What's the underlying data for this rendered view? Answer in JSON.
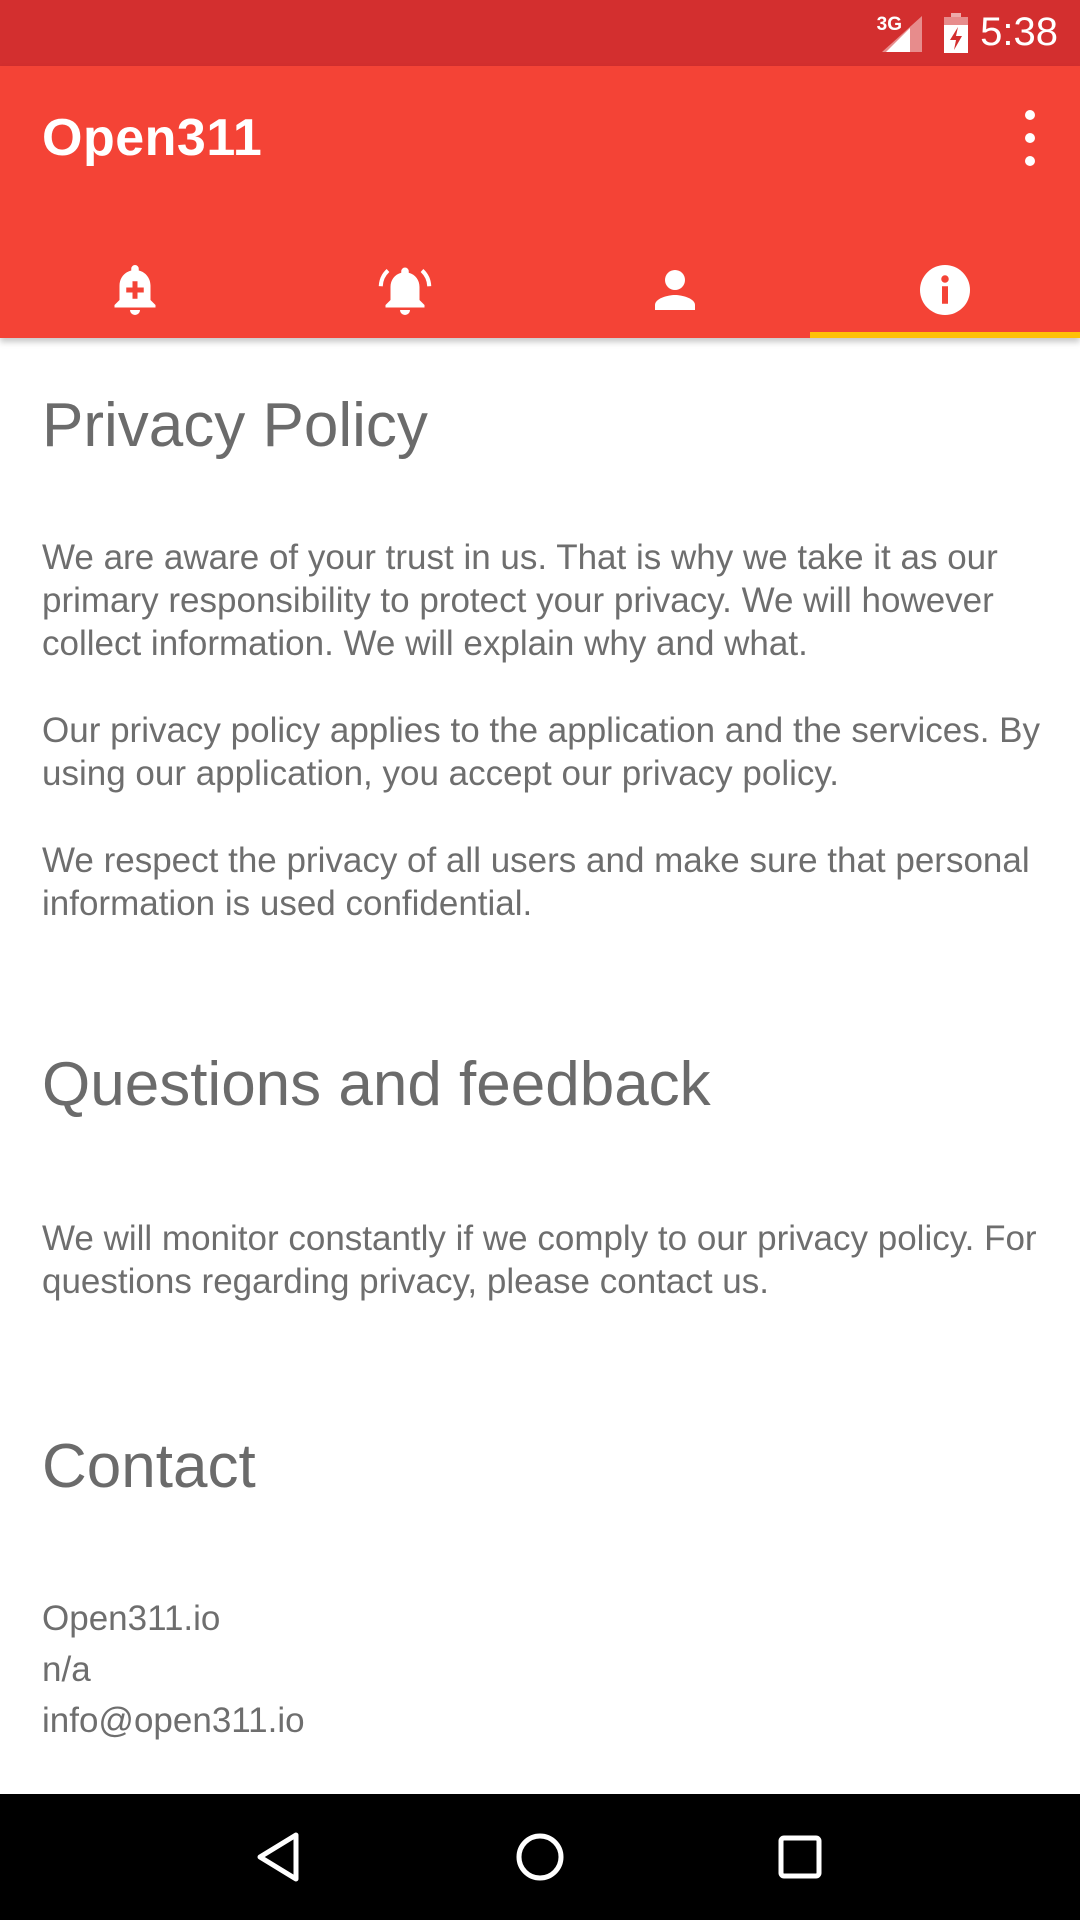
{
  "status_bar": {
    "network": "3G",
    "time": "5:38",
    "background_color": "#d32f2f",
    "icons": [
      "signal-icon",
      "battery-charging-icon"
    ]
  },
  "app_bar": {
    "title": "Open311",
    "background_color": "#f44336",
    "overflow_icon": "more-vert-icon",
    "tabs": [
      {
        "icon": "add-alert-icon",
        "active": false
      },
      {
        "icon": "notifications-active-icon",
        "active": false
      },
      {
        "icon": "person-icon",
        "active": false
      },
      {
        "icon": "info-icon",
        "active": true
      }
    ],
    "indicator_color": "#ffc107"
  },
  "content": {
    "privacy_title": "Privacy Policy",
    "privacy_p1": "We are aware of your trust in us. That is why we take it as our primary responsibility to protect your privacy. We will however collect information. We will explain why and what.",
    "privacy_p2": "Our privacy policy applies to the application and the services. By using our application, you accept our privacy policy.",
    "privacy_p3": "We respect the privacy of all users and make sure that personal information is used confidential.",
    "questions_title": "Questions and feedback",
    "questions_p": "We will monitor constantly if we comply to our privacy policy. For questions regarding privacy, please contact us.",
    "contact_title": "Contact",
    "contact_lines": [
      "Open311.io",
      "n/a",
      "info@open311.io"
    ]
  },
  "nav_bar": {
    "buttons": [
      "back-icon",
      "home-icon",
      "recents-icon"
    ]
  }
}
